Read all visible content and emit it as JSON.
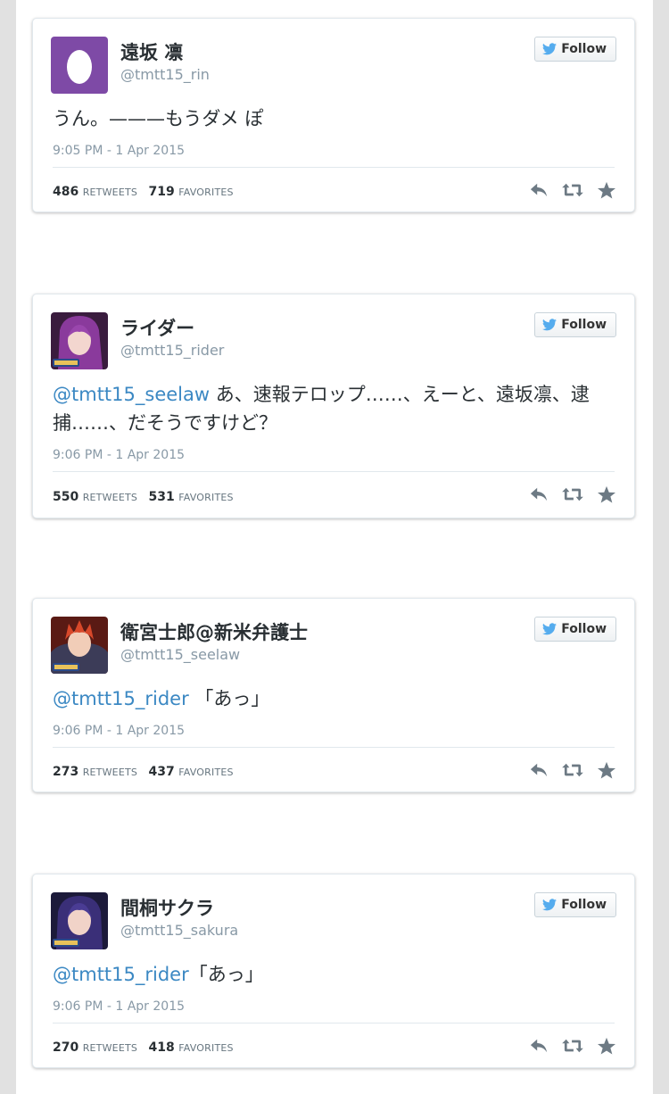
{
  "follow_label": "Follow",
  "retweets_label": "RETWEETS",
  "favorites_label": "FAVORITES",
  "tweets": [
    {
      "name": "遠坂 凛",
      "handle": "@tmtt15_rin",
      "mention": "",
      "text": "うん。———もうダメ ぽ",
      "time": "9:05 PM - 1 Apr 2015",
      "retweets": "486",
      "favorites": "719"
    },
    {
      "name": "ライダー",
      "handle": "@tmtt15_rider",
      "mention": "@tmtt15_seelaw",
      "text": " あ、速報テロップ……、えーと、遠坂凛、逮捕……、だそうですけど？",
      "time": "9:06 PM - 1 Apr 2015",
      "retweets": "550",
      "favorites": "531"
    },
    {
      "name": "衛宮士郎@新米弁護士",
      "handle": "@tmtt15_seelaw",
      "mention": "@tmtt15_rider",
      "text": " 「あっ」",
      "time": "9:06 PM - 1 Apr 2015",
      "retweets": "273",
      "favorites": "437"
    },
    {
      "name": "間桐サクラ",
      "handle": "@tmtt15_sakura",
      "mention": "@tmtt15_rider",
      "text": "「あっ」",
      "time": "9:06 PM - 1 Apr 2015",
      "retweets": "270",
      "favorites": "418"
    }
  ],
  "colors": {
    "mention": "#3b88c3",
    "twitter_bird": "#55acee",
    "egg_avatar_bg": "#7e4aa6",
    "muted": "#8899a6"
  },
  "icons": [
    "twitter-bird-icon",
    "reply-icon",
    "retweet-icon",
    "favorite-star-icon"
  ]
}
